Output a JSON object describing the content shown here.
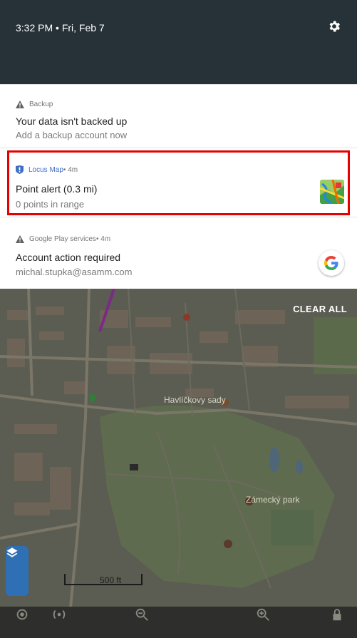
{
  "status_bar": {
    "datetime": "3:32 PM • Fri, Feb 7"
  },
  "notifications": [
    {
      "app": "Backup",
      "meta": "",
      "title": "Your data isn't backed up",
      "text": "Add a backup account now",
      "icon": "warning-triangle-icon"
    },
    {
      "app": "Locus Map",
      "meta": " • 4m",
      "title": "Point alert (0.3 mi)",
      "text": "0 points in range",
      "icon": "locus-map-icon",
      "highlighted": true
    },
    {
      "app": "Google Play services",
      "meta": " • 4m",
      "title": "Account action required",
      "text": "michal.stupka@asamm.com",
      "icon": "warning-triangle-icon"
    }
  ],
  "clear_all_label": "CLEAR ALL",
  "map": {
    "labels": {
      "sady": "Havlíčkovy sady",
      "park": "Zámecký park",
      "scale": "500 ft"
    }
  },
  "colors": {
    "header_bg": "#263238",
    "highlight": "#e60000",
    "locus_blue": "#3f6fc3",
    "layers_button": "#2f6fb4"
  }
}
